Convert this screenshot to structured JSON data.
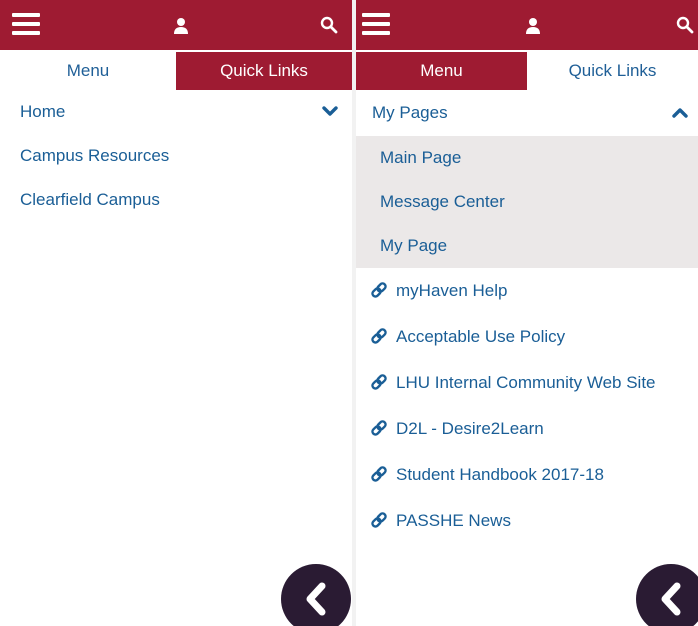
{
  "colors": {
    "brand": "#9e1b32",
    "link": "#1a5e96",
    "submenu_bg": "#ebe8e8",
    "back_button": "#2a1b33"
  },
  "left_panel": {
    "tabs": [
      {
        "label": "Menu",
        "active": false
      },
      {
        "label": "Quick Links",
        "active": true
      }
    ],
    "nav_items": [
      {
        "label": "Home",
        "icon": "chevron-down-icon"
      },
      {
        "label": "Campus Resources"
      },
      {
        "label": "Clearfield Campus"
      }
    ]
  },
  "right_panel": {
    "tabs": [
      {
        "label": "Menu",
        "active": true
      },
      {
        "label": "Quick Links",
        "active": false
      }
    ],
    "section": {
      "label": "My Pages",
      "icon": "chevron-up-icon"
    },
    "sub_items": [
      {
        "label": "Main Page"
      },
      {
        "label": "Message Center"
      },
      {
        "label": "My Page"
      }
    ],
    "links": [
      {
        "label": "myHaven Help",
        "icon": "link-icon"
      },
      {
        "label": "Acceptable Use Policy",
        "icon": "link-icon"
      },
      {
        "label": "LHU Internal Community Web Site",
        "icon": "link-icon"
      },
      {
        "label": "D2L - Desire2Learn",
        "icon": "link-icon"
      },
      {
        "label": "Student Handbook 2017-18",
        "icon": "link-icon"
      },
      {
        "label": "PASSHE News",
        "icon": "link-icon"
      }
    ]
  }
}
